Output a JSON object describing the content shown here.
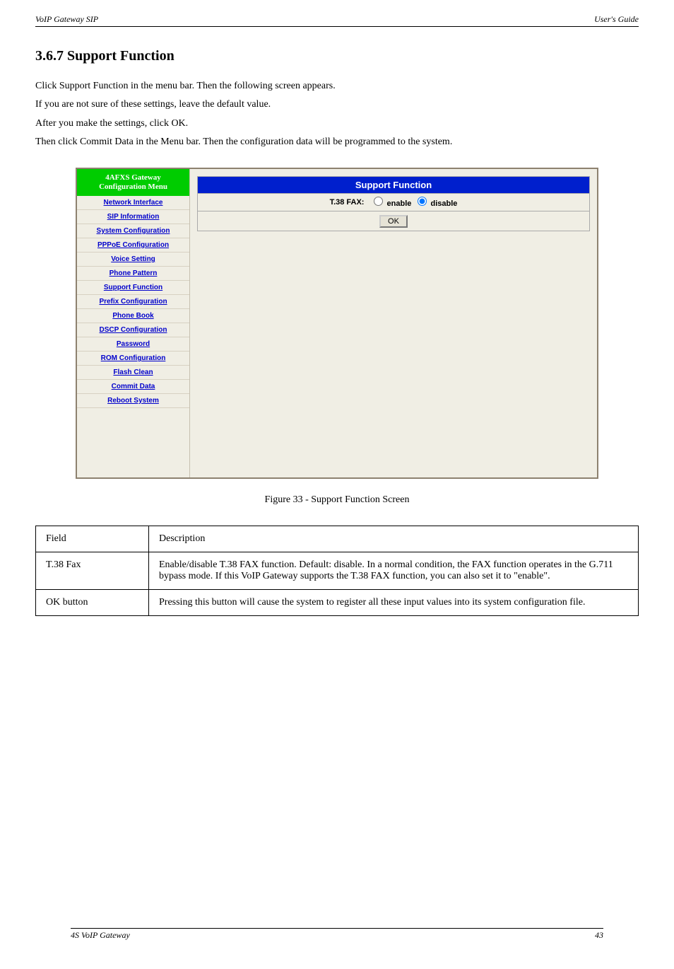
{
  "header": {
    "left": "VoIP Gateway SIP",
    "right": "User's Guide"
  },
  "title": "3.6.7 Support Function",
  "intro": {
    "line1": "Click Support Function in the menu bar. Then the following screen appears.",
    "line2": "If you are not sure of these settings, leave the default value.",
    "line3": "After you make the settings, click OK.",
    "line4": "Then click Commit Data in the Menu bar. Then the configuration data will be programmed to the system."
  },
  "sidebar": {
    "head1": "4AFXS Gateway",
    "head2": "Configuration Menu",
    "items": [
      "Network Interface",
      "SIP Information",
      "System Configuration",
      "PPPoE Configuration",
      "Voice Setting",
      "Phone Pattern",
      "Support Function",
      "Prefix Configuration",
      "Phone Book",
      "DSCP Configuration",
      "Password",
      "ROM Configuration",
      "Flash Clean",
      "Commit Data",
      "Reboot System"
    ]
  },
  "panel": {
    "title": "Support Function",
    "field_label": "T.38 FAX:",
    "opt_enable": "enable",
    "opt_disable": "disable",
    "ok": "OK"
  },
  "figcap": "Figure 33 - Support Function Screen",
  "table": {
    "h_field": "Field",
    "h_desc": "Description",
    "r1_f": "T.38 Fax",
    "r1_d": "Enable/disable T.38 FAX function. Default: disable. In a normal condition, the FAX function operates in the G.711 bypass mode. If this VoIP Gateway supports the T.38 FAX function, you can also set it to \"enable\".",
    "r2_f": "OK button",
    "r2_d": "Pressing this button will cause the system to register all these input values into its system configuration file."
  },
  "footer": {
    "left": "4S VoIP Gateway",
    "right": "43"
  }
}
